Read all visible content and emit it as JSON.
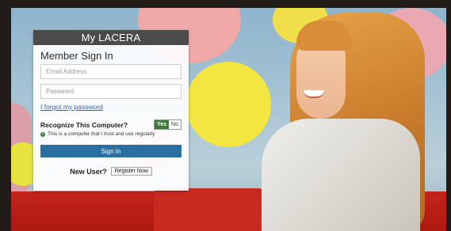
{
  "brand": {
    "logo_text": "My LACERA"
  },
  "login": {
    "title": "Member Sign In",
    "email_placeholder": "Email Address",
    "password_placeholder": "Password",
    "forgot_link": "I forgot my password",
    "recognize_label": "Recognize This Computer?",
    "toggle_yes": "Yes",
    "toggle_no": "No",
    "trust_text": "This is a computer that I trust and use regularly",
    "signin_button": "Sign In",
    "new_user_label": "New User?",
    "register_button": "Register Now"
  },
  "colors": {
    "header_bar": "#4b4b4b",
    "signin_button": "#2a6fa0",
    "toggle_selected": "#3f7a3a",
    "link": "#2f64a4"
  },
  "icons": {
    "trust_check": "check-circle-icon"
  }
}
